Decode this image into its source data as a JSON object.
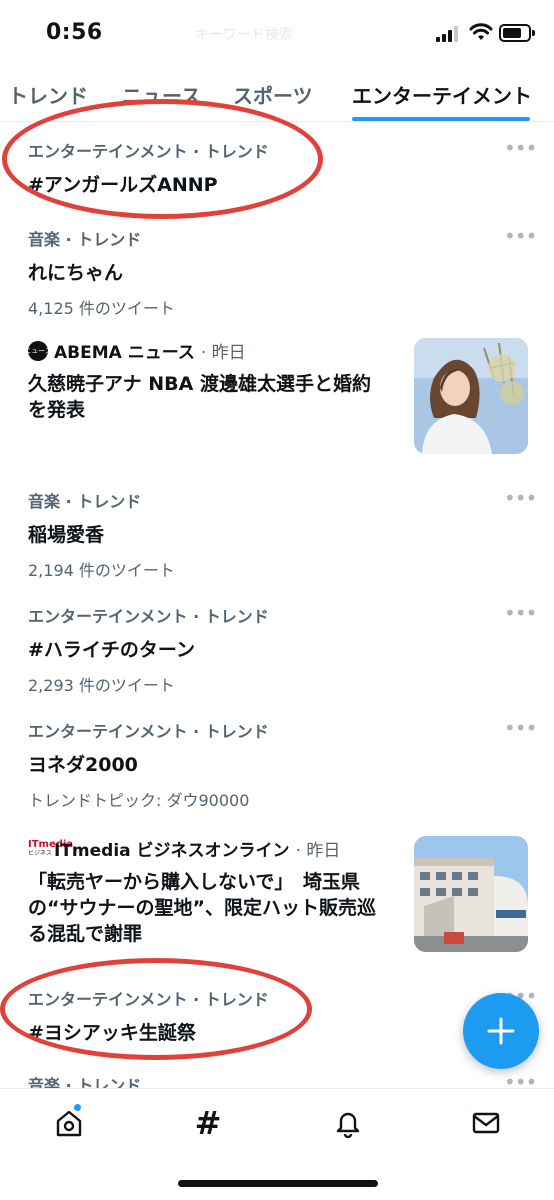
{
  "status_bar": {
    "time": "0:56",
    "ghost_text": "キーワード検索"
  },
  "tabs": [
    {
      "label": "トレンド"
    },
    {
      "label": "ニュース"
    },
    {
      "label": "スポーツ"
    },
    {
      "label": "エンターテイメント",
      "active": true
    }
  ],
  "feed": {
    "trend1": {
      "meta": "エンターテインメント · トレンド",
      "name": "#アンガールズANNP"
    },
    "trend2": {
      "meta": "音楽 · トレンド",
      "name": "れにちゃん",
      "count": "4,125 件のツイート"
    },
    "news1": {
      "source_logo_text": "ニュース",
      "source": "ABEMA ニュース",
      "time": "· 昨日",
      "headline": "久慈暁子アナ NBA 渡邊雄太選手と婚約を発表"
    },
    "trend3": {
      "meta": "音楽 · トレンド",
      "name": "稲場愛香",
      "count": "2,194 件のツイート"
    },
    "trend4": {
      "meta": "エンターテインメント · トレンド",
      "name": "#ハライチのターン",
      "count": "2,293 件のツイート"
    },
    "trend5": {
      "meta": "エンターテインメント · トレンド",
      "name": "ヨネダ2000",
      "count": "トレンドトピック: ダウ90000"
    },
    "news2": {
      "source_logo_text": "ITmedia",
      "source_logo_sub": "ビジネス",
      "source": "ITmedia ビジネスオンライン",
      "time": "· 昨日",
      "headline": "「転売ヤーから購入しないで」　埼玉県の“サウナーの聖地”、限定ハット販売巡る混乱で謝罪"
    },
    "trend6": {
      "meta": "エンターテインメント · トレンド",
      "name": "#ヨシアッキ生誕祭"
    },
    "trend7": {
      "meta": "音楽 · トレンド"
    },
    "more_label": "•••"
  },
  "bottom_nav": [
    {
      "icon": "home-icon",
      "has_notification_dot": true
    },
    {
      "icon": "hashtag-icon",
      "label": "#",
      "active": true
    },
    {
      "icon": "bell-icon"
    },
    {
      "icon": "mail-icon"
    }
  ],
  "colors": {
    "accent": "#1d9bf0",
    "annotation": "#e0423a",
    "secondary_text": "#536471"
  }
}
